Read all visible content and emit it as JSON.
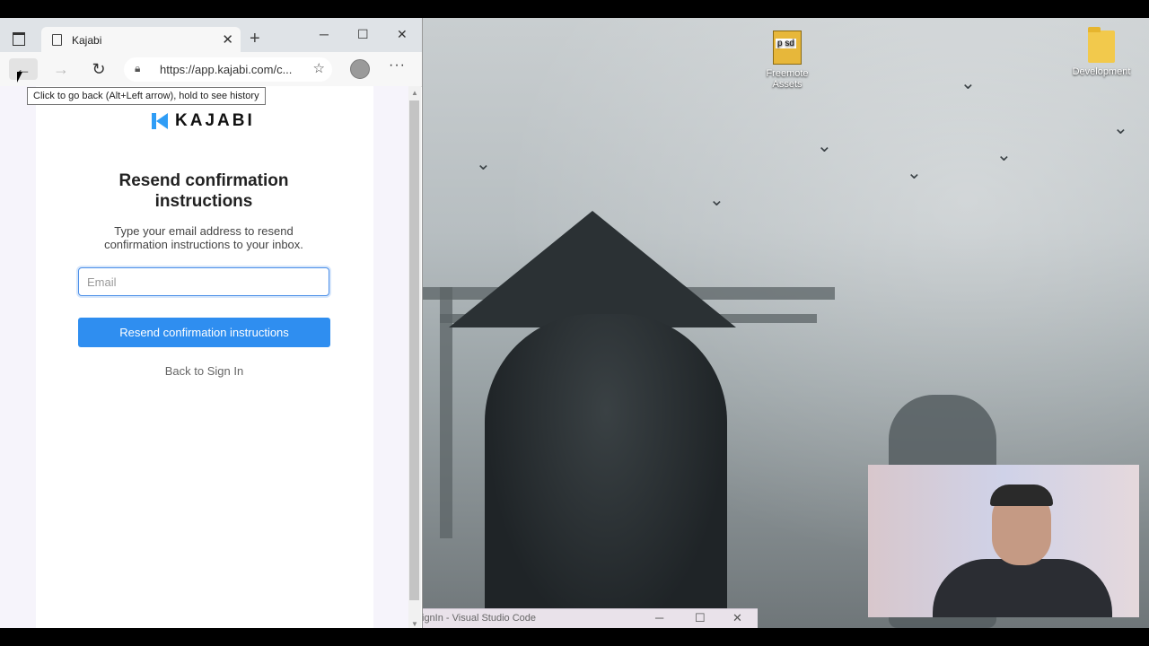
{
  "browser": {
    "tab_title": "Kajabi",
    "url": "https://app.kajabi.com/c...",
    "tooltip": "Click to go back (Alt+Left arrow), hold to see history"
  },
  "page": {
    "logo_text": "KAJABI",
    "heading": "Resend confirmation instructions",
    "description": "Type your email address to resend confirmation instructions to your inbox.",
    "email_placeholder": "Email",
    "submit_label": "Resend confirmation instructions",
    "back_link": "Back to Sign In"
  },
  "desktop": {
    "icons": [
      {
        "label": "Freemote Assets",
        "icon": "psd-file-icon"
      },
      {
        "label": "Development",
        "icon": "folder-icon"
      }
    ]
  },
  "taskbar_window": {
    "title": "ignIn - Visual Studio Code"
  },
  "colors": {
    "accent": "#2f8ef0",
    "logo": "#2f9df6"
  }
}
